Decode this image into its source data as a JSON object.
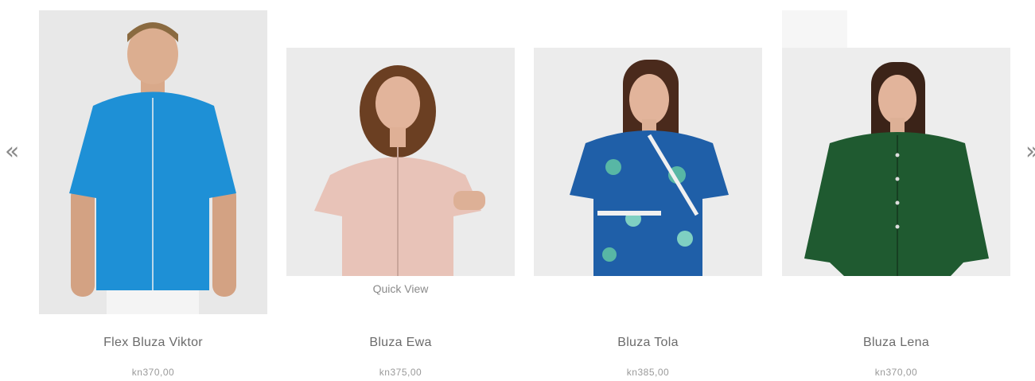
{
  "gallery": {
    "prev_icon": "«",
    "next_icon": "»",
    "quick_view_label": "Quick View",
    "products": [
      {
        "name": "Flex Bluza Viktor",
        "price": "kn370,00",
        "color": "#1e90d6"
      },
      {
        "name": "Bluza Ewa",
        "price": "kn375,00",
        "color": "#e8c3b8"
      },
      {
        "name": "Bluza Tola",
        "price": "kn385,00",
        "color": "#1f5fa8"
      },
      {
        "name": "Bluza Lena",
        "price": "kn370,00",
        "color": "#1f5a30"
      }
    ]
  }
}
